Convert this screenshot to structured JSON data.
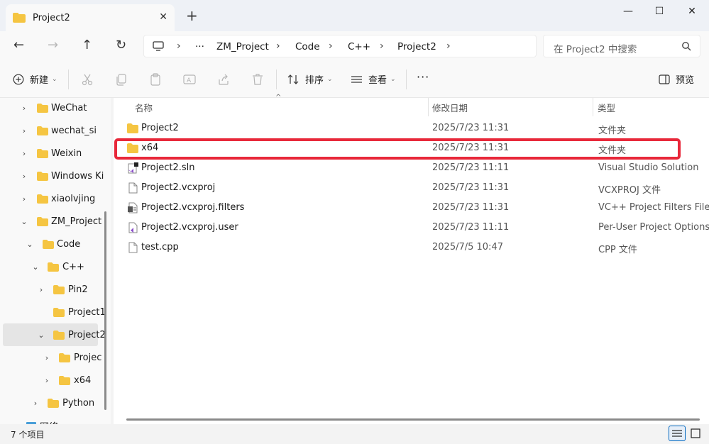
{
  "window": {
    "tab_title": "Project2",
    "close_tab": "✕",
    "new_tab": "+",
    "minimize": "—",
    "maximize": "☐",
    "close": "✕"
  },
  "nav": {
    "breadcrumb": [
      "ZM_Project",
      "Code",
      "C++",
      "Project2"
    ],
    "ellipsis": "···",
    "search_placeholder": "在 Project2 中搜索"
  },
  "toolbar": {
    "new_label": "新建",
    "sort_label": "排序",
    "view_label": "查看",
    "more_label": "···",
    "preview_label": "预览"
  },
  "sidebar": {
    "items": [
      {
        "label": "WeChat",
        "expanded": false
      },
      {
        "label": "wechat_si",
        "expanded": false
      },
      {
        "label": "Weixin",
        "expanded": false
      },
      {
        "label": "Windows Ki",
        "expanded": false
      },
      {
        "label": "xiaolvjing",
        "expanded": false
      },
      {
        "label": "ZM_Project",
        "expanded": true
      },
      {
        "label": "Code",
        "expanded": true
      },
      {
        "label": "C++",
        "expanded": true
      },
      {
        "label": "Pin2",
        "expanded": false
      },
      {
        "label": "Project1",
        "expanded": false
      },
      {
        "label": "Project2",
        "expanded": true,
        "selected": true
      },
      {
        "label": "Projec",
        "expanded": false
      },
      {
        "label": "x64",
        "expanded": false
      },
      {
        "label": "Python",
        "expanded": false
      },
      {
        "label": "网络",
        "expanded": false
      }
    ]
  },
  "list": {
    "columns": {
      "name": "名称",
      "date": "修改日期",
      "type": "类型"
    },
    "rows": [
      {
        "name": "Project2",
        "date": "2025/7/23 11:31",
        "type": "文件夹",
        "icon": "folder-icon"
      },
      {
        "name": "x64",
        "date": "2025/7/23 11:31",
        "type": "文件夹",
        "icon": "folder-icon"
      },
      {
        "name": "Project2.sln",
        "date": "2025/7/23 11:11",
        "type": "Visual Studio Solution",
        "icon": "vs-solution-icon"
      },
      {
        "name": "Project2.vcxproj",
        "date": "2025/7/23 11:31",
        "type": "VCXPROJ 文件",
        "icon": "file-icon"
      },
      {
        "name": "Project2.vcxproj.filters",
        "date": "2025/7/23 11:31",
        "type": "VC++ Project Filters File",
        "icon": "filters-file-icon"
      },
      {
        "name": "Project2.vcxproj.user",
        "date": "2025/7/23 11:11",
        "type": "Per-User Project Options F",
        "icon": "vs-user-icon"
      },
      {
        "name": "test.cpp",
        "date": "2025/7/5 10:47",
        "type": "CPP 文件",
        "icon": "file-icon"
      }
    ]
  },
  "status": {
    "item_count": "7 个项目"
  },
  "colors": {
    "highlight": "#e8283a",
    "folder": "#f5c542",
    "accent": "#0067c0"
  }
}
